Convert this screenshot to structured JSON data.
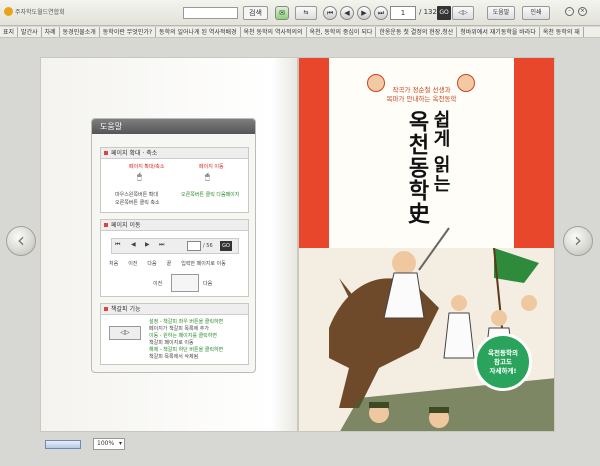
{
  "app": {
    "title": "주자학도월드연합회"
  },
  "toolbar": {
    "search_button": "검색",
    "page_current": "1",
    "page_total": "/ 132",
    "go_label": "GO",
    "view_toggle": "◁▷",
    "help_label": "도움말",
    "print_label": "인쇄"
  },
  "toc": [
    "표지",
    "발간사",
    "차례",
    "동경인물소개",
    "동학이란 무엇인가?",
    "동학의 일어나게 된 역사적배경",
    "옥천 동학의 역사적의의",
    "옥천, 동학의 중심이 되다",
    "한옹운동 첫 결정의 현장,청산",
    "청바위에서 재기동학을 바라다",
    "옥천 동학의 재"
  ],
  "help": {
    "title": "도움말",
    "sec1_title": "페이지 확대 · 축소",
    "sec1_left_label": "페이지 확대/축소",
    "sec1_right_label": "페이지 이동",
    "sec1_left_desc1": "마우스왼쪽버튼 확대",
    "sec1_left_desc2": "오른쪽버튼 클릭 축소",
    "sec1_right_desc": "오른쪽버튼 클릭 다음페이지",
    "sec2_title": "페이지 이동",
    "sec2_total": "/ 56",
    "sec2_go": "GO",
    "sec2_labels": [
      "처음",
      "이전",
      "다음",
      "끝",
      "입력한 페이지로 이동"
    ],
    "sec2_prev": "이전",
    "sec2_next": "다음",
    "sec3_title": "책갈피 기능",
    "sec3_lines": [
      "설정 - 책갈피 좌우 버튼을 클릭하면",
      "페이지가 책갈피 목록에 추가",
      "이동 - 원하는 페이지를 클릭하면",
      "책갈피 페이지로 이동",
      "해제 - 책갈피 하단 버튼을 클릭하면",
      "책갈피 목록에서 삭제됨"
    ]
  },
  "cover": {
    "subtitle_line1": "작곡가 정순철 선생과",
    "subtitle_line2": "목마가 안내하는 옥천동학",
    "title_col1": "쉽게 읽는",
    "title_col2": "옥천동학史",
    "badge_line1": "옥천동학의",
    "badge_line2": "참고도",
    "badge_line3": "자세하게!"
  },
  "bottom": {
    "zoom": "100%"
  },
  "colors": {
    "cover_red": "#e8472c",
    "badge_green": "#2aa45c"
  }
}
